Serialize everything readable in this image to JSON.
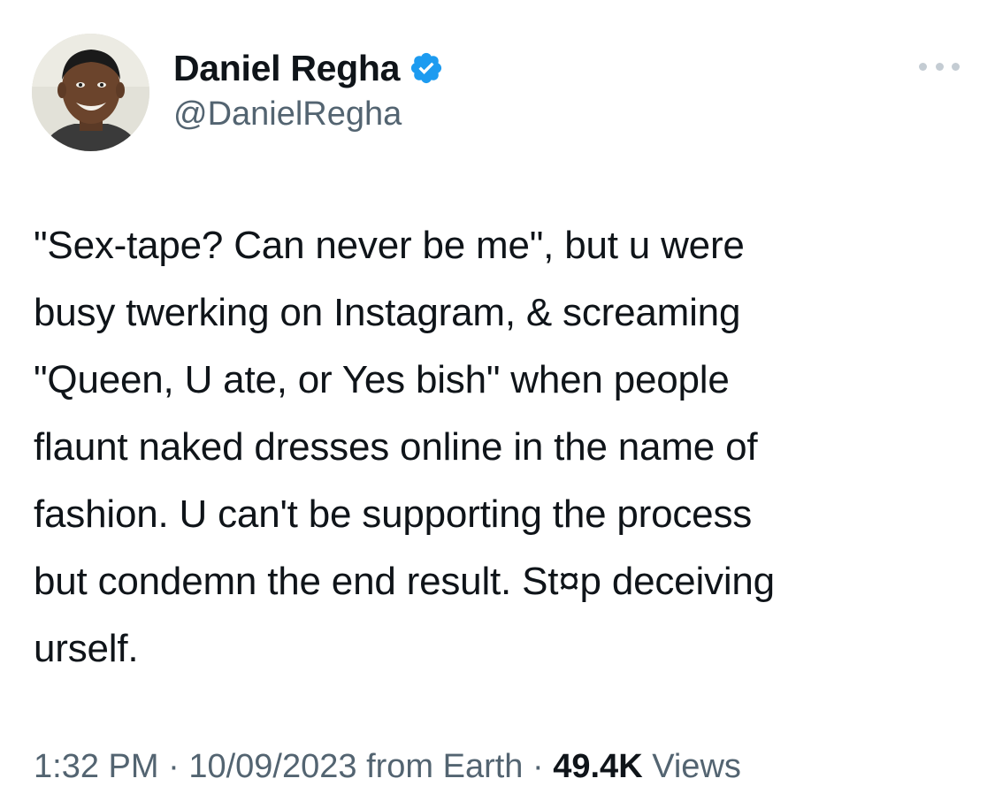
{
  "author": {
    "display_name": "Daniel Regha",
    "handle": "@DanielRegha",
    "verified": true
  },
  "icons": {
    "verified": "verified-badge-icon",
    "more": "more-options-icon",
    "avatar": "user-avatar"
  },
  "colors": {
    "verified_badge": "#1d9bf0",
    "secondary_text": "#536471",
    "primary_text": "#0f1419"
  },
  "tweet": {
    "lines": [
      "\"Sex-tape? Can never be me\", but u were",
      "busy twerking on Instagram, & screaming",
      "\"Queen, U ate, or Yes bish\" when people",
      "flaunt naked dresses online in the name of",
      "fashion. U can't be supporting the process",
      "but condemn the end result. St¤p deceiving",
      "urself."
    ]
  },
  "meta": {
    "time": "1:32 PM",
    "separator": "·",
    "date": "10/09/2023",
    "source": "from Earth",
    "views_count": "49.4K",
    "views_label": "Views"
  }
}
